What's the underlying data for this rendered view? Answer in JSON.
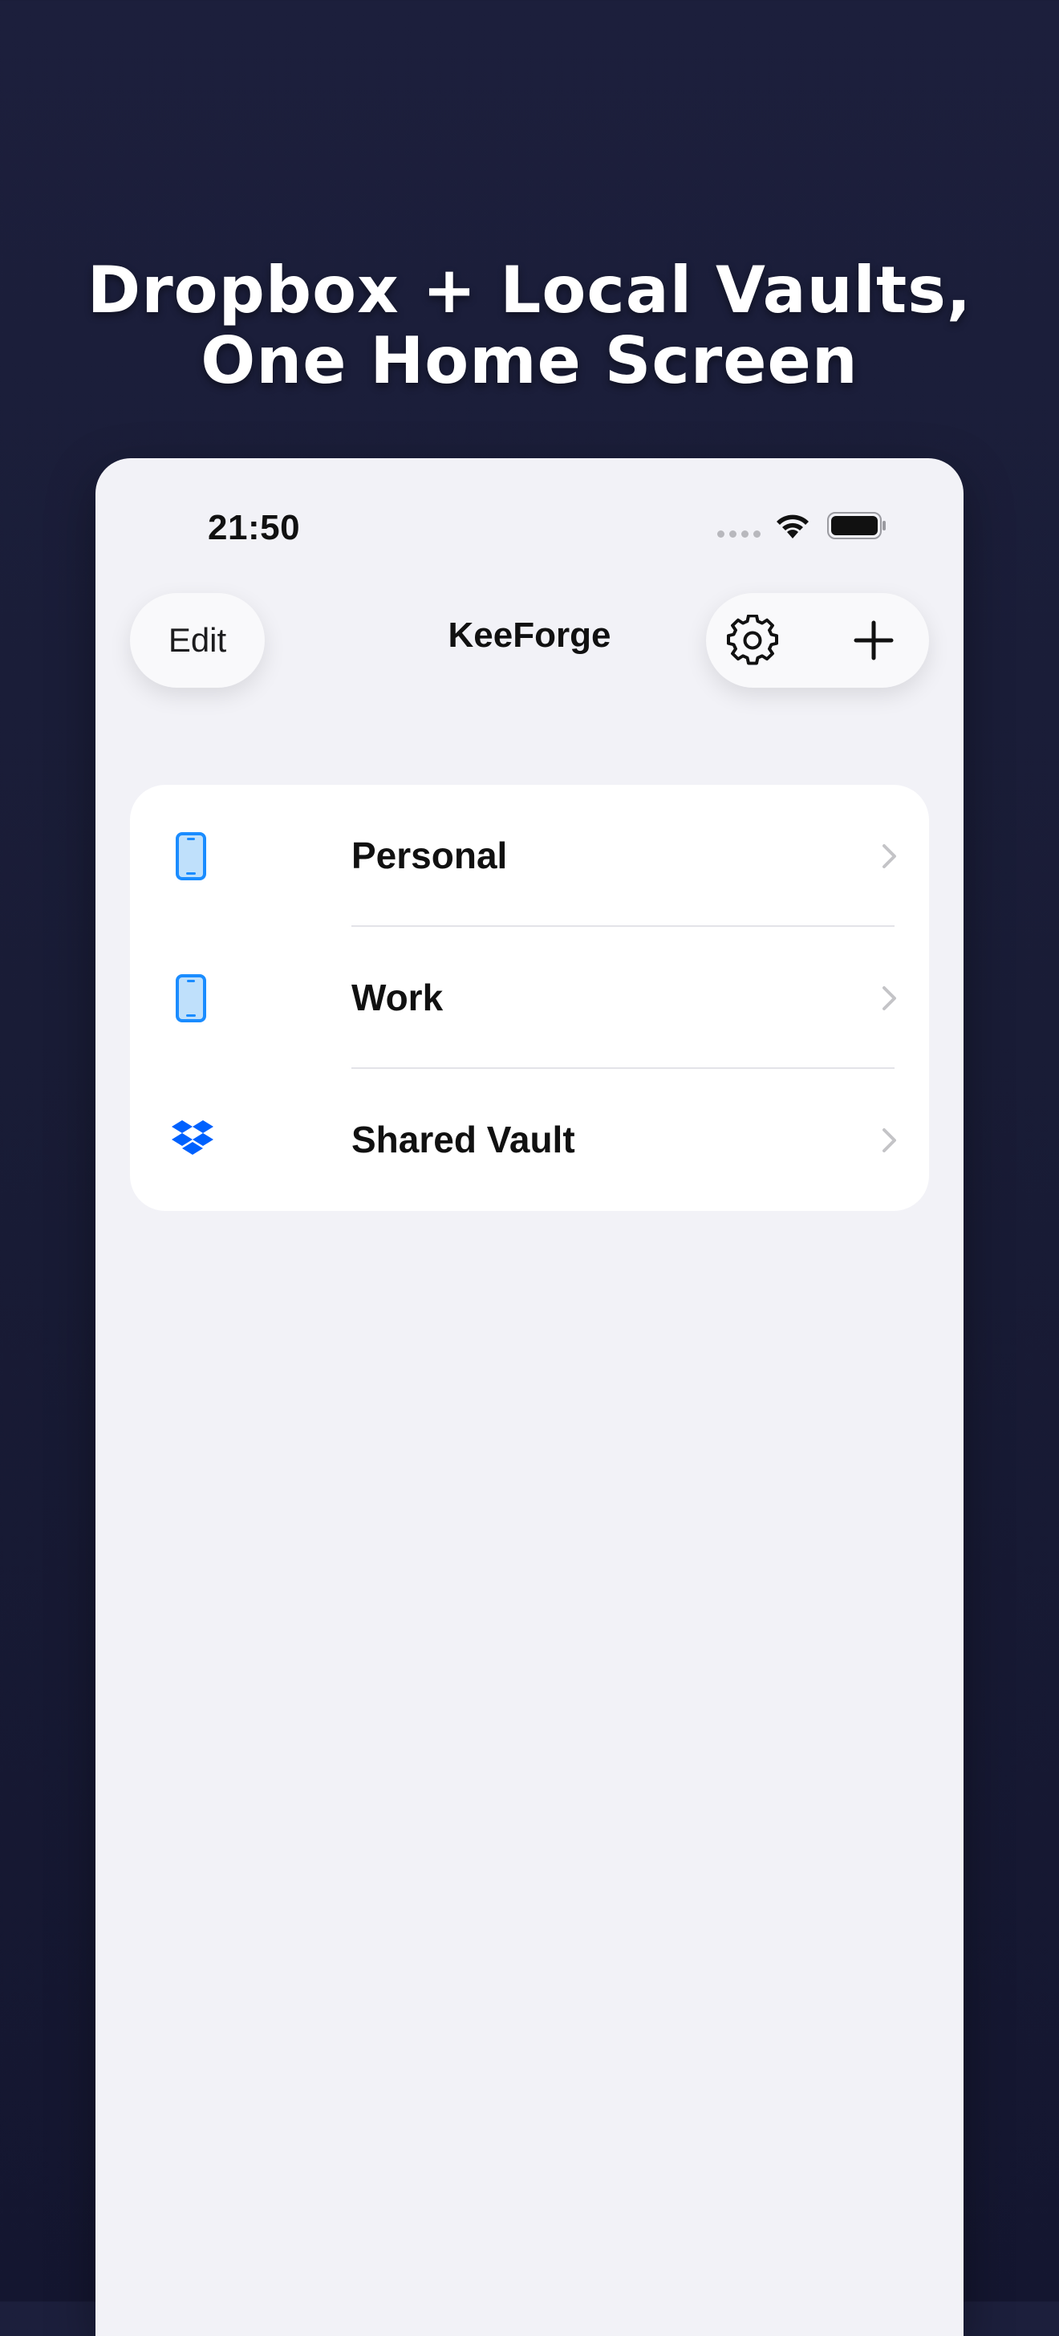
{
  "marketing": {
    "headline_line1": "Dropbox + Local Vaults,",
    "headline_line2": "One Home Screen"
  },
  "status_bar": {
    "time": "21:50",
    "icons": [
      "cellular-signal-icon",
      "wifi-icon",
      "battery-icon"
    ]
  },
  "nav_bar": {
    "edit_label": "Edit",
    "title": "KeeForge",
    "actions": [
      "gear-icon",
      "plus-icon"
    ]
  },
  "vaults": [
    {
      "label": "Personal",
      "icon": "phone-icon",
      "storage": "local"
    },
    {
      "label": "Work",
      "icon": "phone-icon",
      "storage": "local"
    },
    {
      "label": "Shared Vault",
      "icon": "dropbox-icon",
      "storage": "dropbox"
    }
  ],
  "colors": {
    "background": "#1c1f3c",
    "screen": "#f2f2f7",
    "card": "#ffffff",
    "accent_blue": "#1a8cff",
    "dropbox_blue": "#0061fe",
    "chevron": "#c4c4c7"
  }
}
